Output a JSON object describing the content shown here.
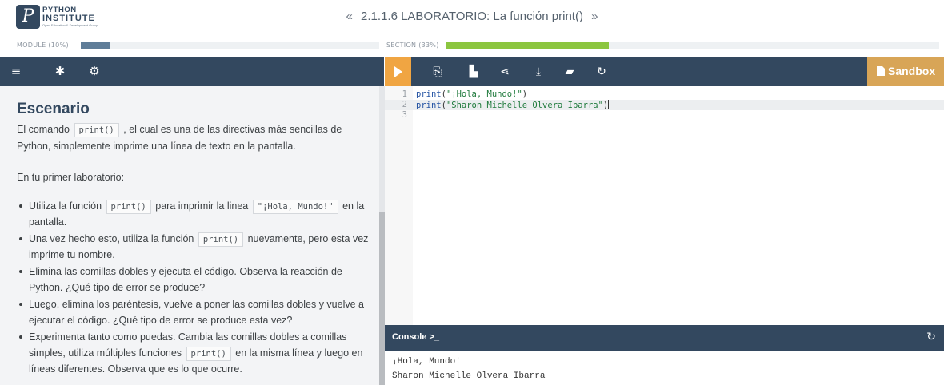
{
  "header": {
    "logo": {
      "line1": "PYTHON",
      "line2": "INSTITUTE",
      "line3": "Open Education & Development Group",
      "mark": "P"
    },
    "prev_icon": "«",
    "next_icon": "»",
    "title": "2.1.1.6 LABORATORIO: La función print()"
  },
  "progress": {
    "module_label": "MODULE (10%)",
    "module_value": 0.1,
    "section_label": "SECTION (33%)",
    "section_value": 0.33,
    "module_color": "#5f7d98",
    "section_color": "#8cc63f"
  },
  "left_toolbar": {
    "icons": [
      "menu-icon",
      "bug-icon",
      "gear-icon"
    ],
    "menu_glyph": "≡",
    "bug_glyph": "✱",
    "gear_glyph": "⚙"
  },
  "editor_toolbar": {
    "run_icon": "play-icon",
    "icons": [
      "copy-icon",
      "paste-icon",
      "share-icon",
      "download-icon",
      "open-folder-icon",
      "reset-icon"
    ],
    "copy_glyph": "⎘",
    "paste_glyph": "▙",
    "share_glyph": "⋖",
    "download_glyph": "⤓",
    "folder_glyph": "▰",
    "reset_glyph": "↻",
    "sandbox_label": "Sandbox"
  },
  "instructions": {
    "heading": "Escenario",
    "p1_a": "El comando",
    "p1_code": "print()",
    "p1_b": ", el cual es una de las directivas más sencillas de Python, simplemente imprime una línea de texto en la pantalla.",
    "p2": "En tu primer laboratorio:",
    "b1_a": "Utiliza la función",
    "b1_code1": "print()",
    "b1_b": "para imprimir la linea",
    "b1_code2": "\"¡Hola, Mundo!\"",
    "b1_c": "en la pantalla.",
    "b2_a": "Una vez hecho esto, utiliza la función",
    "b2_code": "print()",
    "b2_b": "nuevamente, pero esta vez imprime tu nombre.",
    "b3": "Elimina las comillas dobles y ejecuta el código. Observa la reacción de Python. ¿Qué tipo de error se produce?",
    "b4": "Luego, elimina los paréntesis, vuelve a poner las comillas dobles y vuelve a ejecutar el código. ¿Qué tipo de error se produce esta vez?",
    "b5_a": "Experimenta tanto como puedas. Cambia las comillas dobles a comillas simples, utiliza múltiples funciones",
    "b5_code": "print()",
    "b5_b": "en la misma línea y luego en líneas diferentes. Observa que es lo que ocurre."
  },
  "editor": {
    "lines": [
      {
        "num": "1",
        "fn": "print",
        "open": "(",
        "str": "\"¡Hola, Mundo!\"",
        "close": ")"
      },
      {
        "num": "2",
        "fn": "print",
        "open": "(",
        "str": "\"Sharon Michelle Olvera Ibarra\"",
        "close": ")"
      },
      {
        "num": "3",
        "fn": "",
        "open": "",
        "str": "",
        "close": ""
      }
    ]
  },
  "console": {
    "title": "Console >_",
    "refresh_glyph": "↻",
    "output": [
      "¡Hola, Mundo!",
      "Sharon Michelle Olvera Ibarra"
    ]
  }
}
